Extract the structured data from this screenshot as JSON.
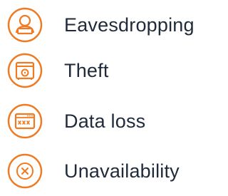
{
  "accent_color": "#f07a22",
  "text_color": "#1f2a3a",
  "items": [
    {
      "label": "Eavesdropping",
      "icon": "person-at-laptop-icon"
    },
    {
      "label": "Theft",
      "icon": "safe-icon"
    },
    {
      "label": "Data loss",
      "icon": "browser-window-password-icon"
    },
    {
      "label": "Unavailability",
      "icon": "x-circle-icon"
    }
  ]
}
